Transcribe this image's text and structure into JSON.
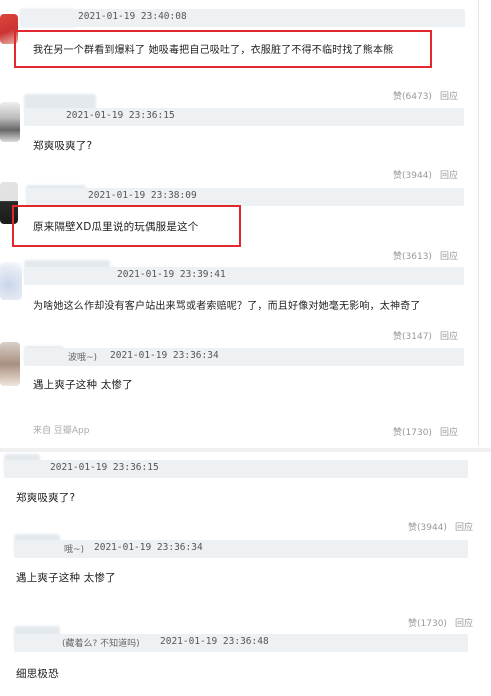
{
  "comments": [
    {
      "time": "2021-01-19 23:40:08",
      "text": "我在另一个群看到爆料了 她吸毒把自己吸吐了，衣服脏了不得不临时找了熊本熊",
      "likes": "赞(6473)",
      "reply": "回应"
    },
    {
      "time": "2021-01-19 23:36:15",
      "text": "郑爽吸爽了?",
      "likes": "赞(3944)",
      "reply": "回应"
    },
    {
      "time": "2021-01-19 23:38:09",
      "text": "原来隔壁XD瓜里说的玩偶服是这个",
      "likes": "赞(3613)",
      "reply": "回应"
    },
    {
      "time": "2021-01-19 23:39:41",
      "text": "为啥她这么作却没有客户站出来骂或者索赔呢？了，而且好像对她毫无影响，太神奇了",
      "likes": "赞(3147)",
      "reply": "回应"
    },
    {
      "name_suffix": "波哦~)",
      "time": "2021-01-19 23:36:34",
      "text": "遇上爽子这种 太惨了",
      "likes": "赞(1730)",
      "reply": "回应",
      "source": "来自 豆瓣App"
    }
  ],
  "repeat": [
    {
      "time": "2021-01-19 23:36:15",
      "text": "郑爽吸爽了?",
      "likes": "赞(3944)",
      "reply": "回应"
    },
    {
      "name_suffix": "哦~)",
      "time": "2021-01-19 23:36:34",
      "text": "遇上爽子这种 太惨了",
      "likes": "赞(1730)",
      "reply": "回应"
    },
    {
      "name_suffix": "(藏着么? 不知道吗)",
      "time": "2021-01-19 23:36:48",
      "text": "细思极恐"
    }
  ],
  "colors": {
    "highlight": "#e0282e",
    "meta_bar": "#eef1f4"
  }
}
